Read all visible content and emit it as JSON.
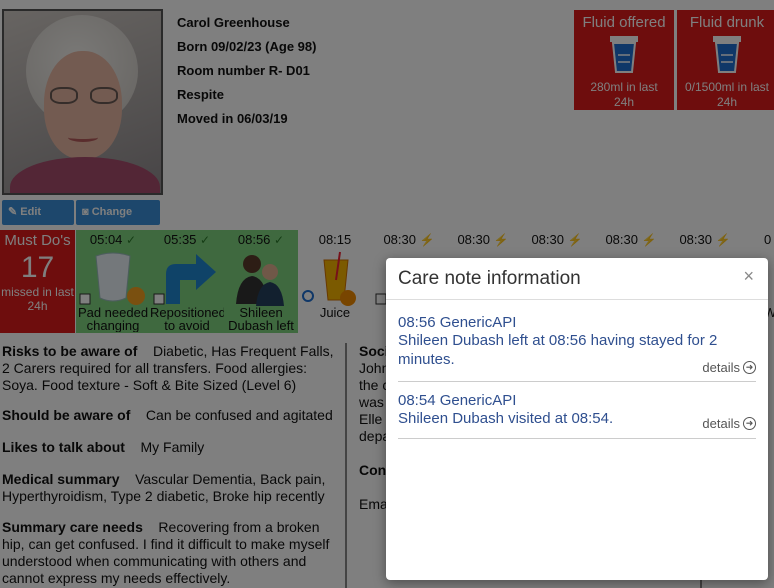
{
  "resident": {
    "name": "Carol Greenhouse",
    "born": "Born 09/02/23 (Age 98)",
    "room": "Room number R- D01",
    "stay_type": "Respite",
    "moved_in": "Moved in 06/03/19",
    "edit_details": "Edit details",
    "change_photo": "Change photo"
  },
  "fluids": {
    "offered": {
      "title": "Fluid offered",
      "summary": "280ml in last 24h"
    },
    "drunk": {
      "title": "Fluid drunk",
      "summary": "0/1500ml in last 24h"
    }
  },
  "must_dos": {
    "title": "Must Do's",
    "count": "17",
    "subtitle": "missed in last 24h"
  },
  "timeline": [
    {
      "time": "05:04",
      "label": "Pad needed changing",
      "icon": "pad-icon",
      "done": true
    },
    {
      "time": "05:35",
      "label": "Repositioned to avoid",
      "icon": "turn-arrow-icon",
      "done": true
    },
    {
      "time": "08:56",
      "label": "Shileen Dubash left",
      "icon": "visitors-icon",
      "done": true
    },
    {
      "time": "08:15",
      "label": "Juice",
      "icon": "juice-icon",
      "done": false
    },
    {
      "time": "08:30",
      "label": "C",
      "icon": "person-icon",
      "done": false
    },
    {
      "time": "08:30",
      "label": "",
      "icon": "",
      "done": false
    },
    {
      "time": "08:30",
      "label": "",
      "icon": "",
      "done": false
    },
    {
      "time": "08:30",
      "label": "",
      "icon": "",
      "done": false
    },
    {
      "time": "08:30",
      "label": "",
      "icon": "",
      "done": false
    },
    {
      "time": "0",
      "label": "W",
      "icon": "",
      "done": false
    }
  ],
  "profile": {
    "risks_label": "Risks to be aware of",
    "risks": "Diabetic, Has Frequent Falls, 2 Carers required for all transfers. Food allergies: Soya. Food texture - Soft & Bite Sized (Level 6)",
    "should_label": "Should be aware of",
    "should": "Can be confused and agitated",
    "likes_label": "Likes to talk about",
    "likes": "My Family",
    "medical_label": "Medical summary",
    "medical": "Vascular Dementia, Back pain, Hyperthyroidism, Type 2 diabetic, Broke hip recently",
    "summary_label": "Summary care needs",
    "summary": "Recovering from a broken hip, can get confused. I find it difficult to make myself understood when communicating with others and cannot express my needs effectively."
  },
  "social": {
    "label": "Soci",
    "lines": [
      "John",
      "the c",
      "was",
      "Elle",
      "depa"
    ],
    "contact_label": "Con",
    "email_label": "Ema"
  },
  "modal": {
    "title": "Care note information",
    "close": "×",
    "notes": [
      {
        "source": "08:56 GenericAPI",
        "text": "Shileen Dubash left at 08:56 having stayed for 2 minutes.",
        "details": "details"
      },
      {
        "source": "08:54 GenericAPI",
        "text": "Shileen Dubash visited at 08:54.",
        "details": "details"
      }
    ]
  },
  "colors": {
    "alert_red": "#dc1a1a",
    "done_green": "#7fd37f",
    "button_blue": "#3a8fd8",
    "note_text": "#2f4f8f"
  }
}
